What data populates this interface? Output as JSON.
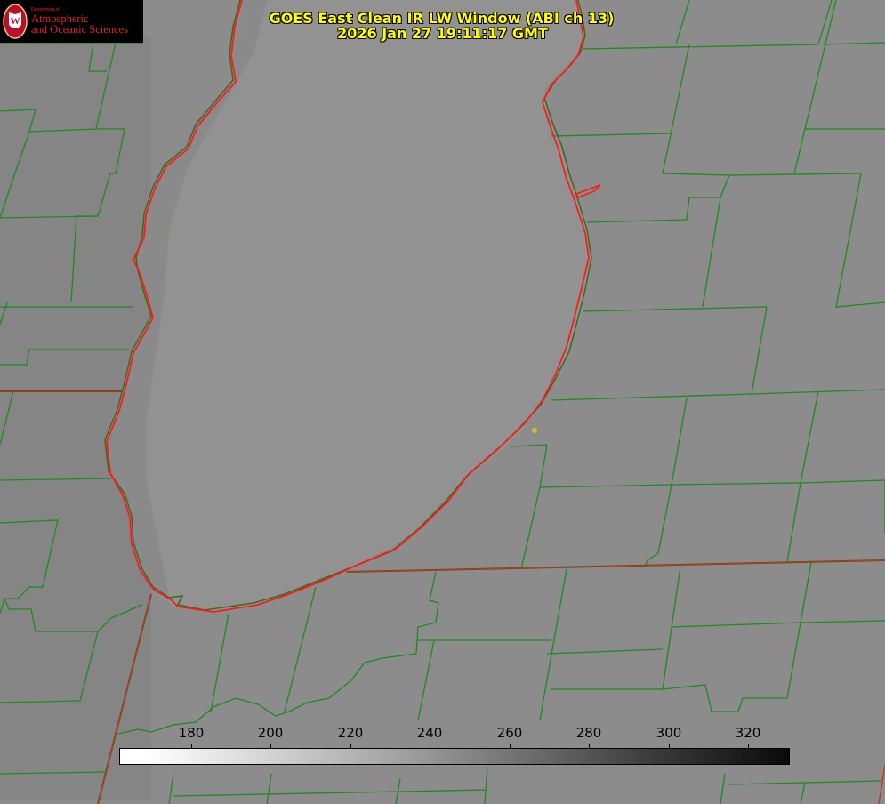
{
  "title": {
    "line1": "GOES East Clean IR LW Window (ABI ch 13)",
    "line2": "2026 Jan 27 19:11:17 GMT"
  },
  "logo": {
    "dept": "Department of",
    "line1": "Atmospheric",
    "line2": "and Oceanic Sciences"
  },
  "colorbar": {
    "ticks": [
      "180",
      "200",
      "220",
      "240",
      "260",
      "280",
      "300",
      "320"
    ]
  },
  "colors": {
    "county_lines": "#1f8a1f",
    "coastline": "#ff1a1a",
    "title": "#ffff00",
    "marker": "#d4c21a"
  }
}
